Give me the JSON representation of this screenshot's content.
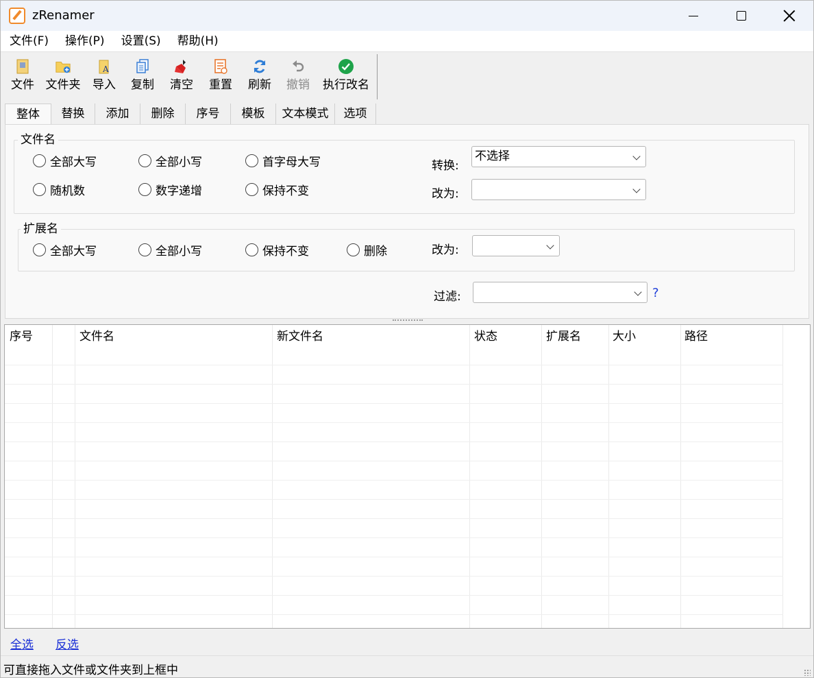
{
  "window": {
    "title": "zRenamer"
  },
  "menu": [
    "文件(F)",
    "操作(P)",
    "设置(S)",
    "帮助(H)"
  ],
  "toolbar": [
    {
      "label": "文件",
      "icon": "file-icon",
      "color": "#e6b23c"
    },
    {
      "label": "文件夹",
      "icon": "folder-add-icon",
      "color": "#f0c14b"
    },
    {
      "label": "导入",
      "icon": "import-icon",
      "color": "#e8c040"
    },
    {
      "label": "复制",
      "icon": "copy-icon",
      "color": "#3a7fd5"
    },
    {
      "label": "清空",
      "icon": "broom-icon",
      "color": "#d62020"
    },
    {
      "label": "重置",
      "icon": "reset-icon",
      "color": "#e8772e"
    },
    {
      "label": "刷新",
      "icon": "refresh-icon",
      "color": "#2e7dd6"
    },
    {
      "label": "撤销",
      "icon": "undo-icon",
      "color": "#8a8a8a"
    },
    {
      "label": "执行改名",
      "icon": "execute-icon",
      "color": "#1ea34a"
    }
  ],
  "tabs": [
    "整体",
    "替换",
    "添加",
    "删除",
    "序号",
    "模板",
    "文本模式",
    "选项"
  ],
  "filename_group": {
    "title": "文件名",
    "options": [
      "全部大写",
      "全部小写",
      "首字母大写",
      "随机数",
      "数字递增",
      "保持不变"
    ],
    "convert_label": "转换:",
    "convert_value": "不选择",
    "change_label": "改为:",
    "change_value": ""
  },
  "extension_group": {
    "title": "扩展名",
    "options": [
      "全部大写",
      "全部小写",
      "保持不变",
      "删除"
    ],
    "change_label": "改为:",
    "change_value": ""
  },
  "filter": {
    "label": "过滤:",
    "value": "",
    "help": "?"
  },
  "list": {
    "columns": [
      "序号",
      "",
      "文件名",
      "新文件名",
      "状态",
      "扩展名",
      "大小",
      "路径"
    ]
  },
  "links": {
    "select_all": "全选",
    "invert": "反选"
  },
  "status": "可直接拖入文件或文件夹到上框中"
}
